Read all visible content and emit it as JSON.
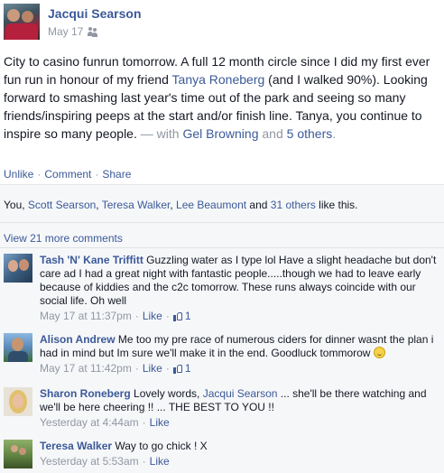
{
  "post": {
    "author": "Jacqui Searson",
    "date": "May 17",
    "privacy_icon": "friends-icon",
    "text_1": "City to casino funrun tomorrow. A full 12 month circle since I did my first ever fun run in honour of my friend ",
    "mention": "Tanya Roneberg",
    "text_2": " (and I walked 90%). Looking forward to smashing last year's time out of the park and seeing so many friends/inspiring peeps at the start and/or finish line. Tanya, you continue to inspire so many people.",
    "with_prefix": " — with ",
    "with_person": "Gel Browning",
    "with_and": " and ",
    "with_others": "5 others",
    "with_end": "."
  },
  "actions": {
    "unlike": "Unlike",
    "comment": "Comment",
    "share": "Share",
    "separator": "·"
  },
  "likes": {
    "you": "You, ",
    "names": [
      "Scott Searson",
      "Teresa Walker",
      "Lee Beaumont"
    ],
    "sep": ", ",
    "and": " and ",
    "others": "31 others",
    "suffix": " like this."
  },
  "view_more": "View 21 more comments",
  "comments": [
    {
      "name": "Tash 'N' Kane Triffitt",
      "text": " Guzzling water as I type lol Have a slight headache but don't care ad I had a great night with fantastic people.....though we had to leave early because of kiddies and the c2c tomorrow. These runs always coincide with our social life. Oh well",
      "time": "May 17 at 11:37pm",
      "like": "Like",
      "like_count": "1"
    },
    {
      "name": "Alison Andrew",
      "text": " Me too my pre race of numerous ciders for dinner wasnt the plan i had in mind but Im sure we'll make it in the end. Goodluck tommorow ",
      "emoji": "smiley-icon",
      "time": "May 17 at 11:42pm",
      "like": "Like",
      "like_count": "1"
    },
    {
      "name": "Sharon Roneberg",
      "text_1": " Lovely words, ",
      "mention": "Jacqui Searson",
      "text_2": " ... she'll be there watching and we'll be here cheering !! ... THE BEST TO YOU !!",
      "time": "Yesterday at 4:44am",
      "like": "Like"
    },
    {
      "name": "Teresa Walker",
      "text": " Way to go chick ! X",
      "time": "Yesterday at 5:53am",
      "like": "Like"
    }
  ],
  "colors": {
    "link": "#3b5998",
    "meta": "#9197a3",
    "feedback_bg": "#f6f7f9"
  }
}
